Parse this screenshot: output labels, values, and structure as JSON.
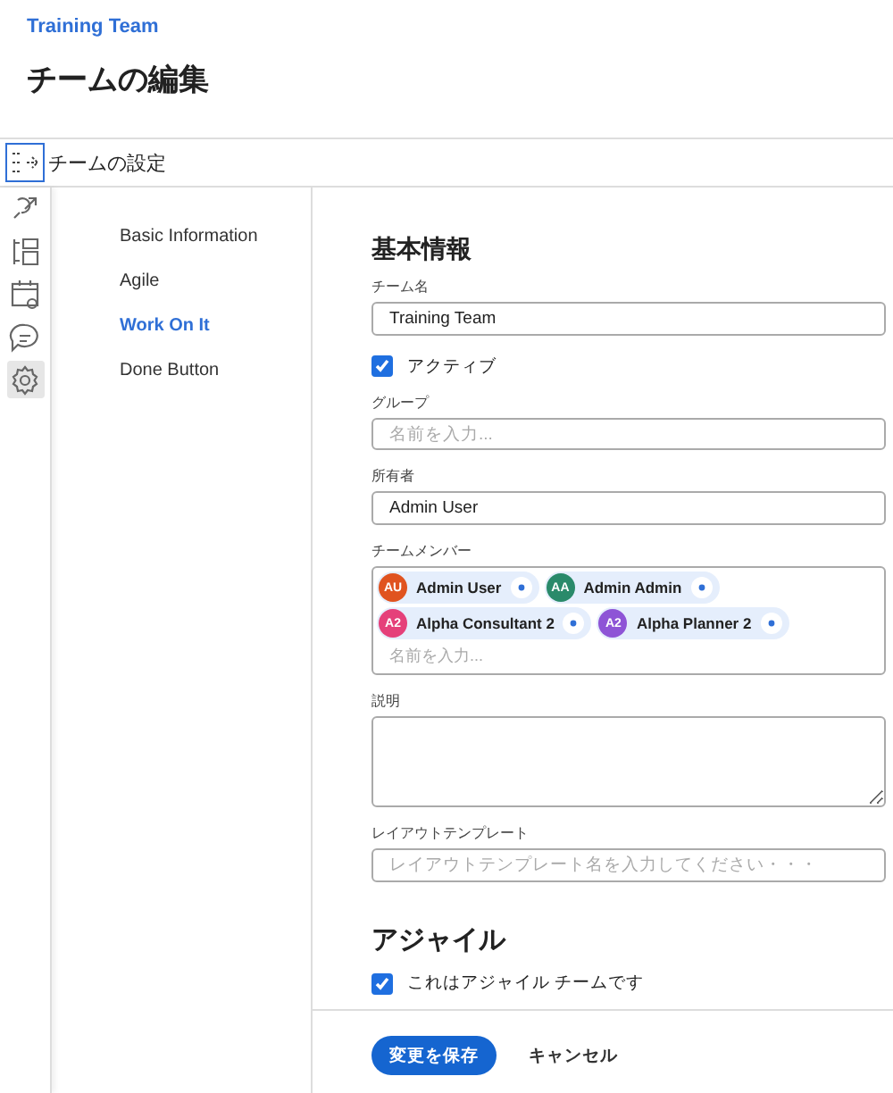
{
  "header": {
    "breadcrumb": "Training Team",
    "title": "チームの編集"
  },
  "settings_bar": {
    "label": "チームの設定"
  },
  "rail": [
    {
      "selected": false
    },
    {
      "selected": false
    },
    {
      "selected": false
    },
    {
      "selected": false
    },
    {
      "selected": true
    }
  ],
  "nav": [
    {
      "label": "Basic Information",
      "selected": false
    },
    {
      "label": "Agile",
      "selected": false
    },
    {
      "label": "Work On It",
      "selected": true
    },
    {
      "label": "Done Button",
      "selected": false
    }
  ],
  "basic": {
    "heading": "基本情報",
    "team_name": {
      "label": "チーム名",
      "value": "Training Team"
    },
    "active": {
      "label": "アクティブ",
      "checked": true
    },
    "group": {
      "label": "グループ",
      "placeholder": "名前を入力..."
    },
    "owner": {
      "label": "所有者",
      "value": "Admin User"
    },
    "members": {
      "label": "チームメンバー",
      "placeholder": "名前を入力...",
      "items": [
        {
          "initials": "AU",
          "name": "Admin User",
          "color": "#e0531f"
        },
        {
          "initials": "AA",
          "name": "Admin Admin",
          "color": "#2a8a6a"
        },
        {
          "initials": "A2",
          "name": "Alpha Consultant 2",
          "color": "#e5407a"
        },
        {
          "initials": "A2",
          "name": "Alpha Planner 2",
          "color": "#8e54d6"
        }
      ]
    },
    "description": {
      "label": "説明"
    },
    "layout_template": {
      "label": "レイアウトテンプレート",
      "placeholder": "レイアウトテンプレート名を入力してください・・・"
    }
  },
  "agile": {
    "heading": "アジャイル",
    "is_agile": {
      "label": "これはアジャイル チームです",
      "checked": true
    }
  },
  "footer": {
    "save": "変更を保存",
    "cancel": "キャンセル"
  }
}
